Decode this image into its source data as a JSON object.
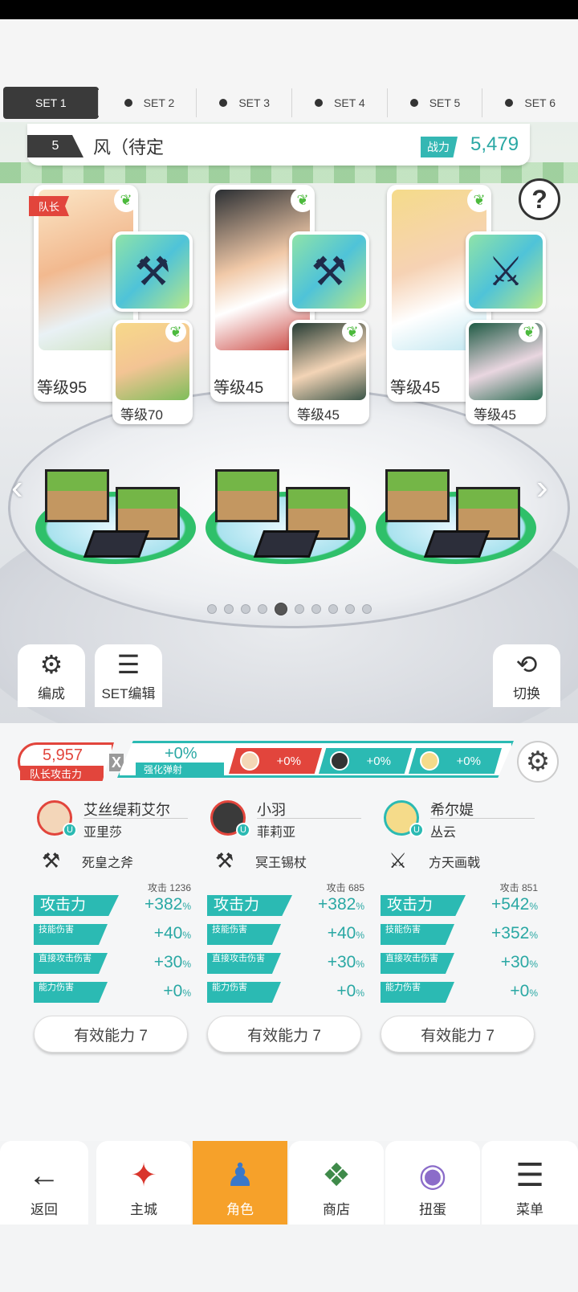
{
  "set_tabs": [
    {
      "label": "SET 1",
      "active": true
    },
    {
      "label": "SET 2",
      "active": false
    },
    {
      "label": "SET 3",
      "active": false
    },
    {
      "label": "SET 4",
      "active": false
    },
    {
      "label": "SET 5",
      "active": false
    },
    {
      "label": "SET 6",
      "active": false
    }
  ],
  "party": {
    "number": "5",
    "name": "风（待定",
    "power_label": "战力",
    "power": "5,479"
  },
  "help_icon": "question-icon",
  "teams": [
    {
      "leader_tag": "队长",
      "main_level": "等级95",
      "sub_level": "等级70",
      "weapon_icon": "axe-icon"
    },
    {
      "main_level": "等级45",
      "sub_level": "等级45",
      "weapon_icon": "axe-icon"
    },
    {
      "main_level": "等级45",
      "sub_level": "等级45",
      "weapon_icon": "halberd-icon"
    }
  ],
  "page_dots": {
    "count": 10,
    "active_index": 4
  },
  "tools": {
    "formation": "编成",
    "set_edit": "SET编辑",
    "switch": "切换"
  },
  "leader_attack": {
    "value": "5,957",
    "label": "队长攻击力"
  },
  "multiplier": "X",
  "enhance": {
    "value": "+0%",
    "label": "强化弹射"
  },
  "chips": [
    "+0%",
    "+0%",
    "+0%"
  ],
  "characters": [
    {
      "name": "艾丝缇莉艾尔",
      "sub": "亚里莎",
      "weapon": "死皇之斧",
      "atk_label": "攻击",
      "atk": "1236",
      "stats": [
        {
          "label": "攻击力",
          "value": "+382",
          "unit": "%"
        },
        {
          "label": "技能伤害",
          "value": "+40",
          "unit": "%"
        },
        {
          "label": "直接攻击伤害",
          "value": "+30",
          "unit": "%"
        },
        {
          "label": "能力伤害",
          "value": "+0",
          "unit": "%"
        }
      ],
      "effective": "有效能力 7"
    },
    {
      "name": "小羽",
      "sub": "菲莉亚",
      "weapon": "冥王锡杖",
      "atk_label": "攻击",
      "atk": "685",
      "stats": [
        {
          "label": "攻击力",
          "value": "+382",
          "unit": "%"
        },
        {
          "label": "技能伤害",
          "value": "+40",
          "unit": "%"
        },
        {
          "label": "直接攻击伤害",
          "value": "+30",
          "unit": "%"
        },
        {
          "label": "能力伤害",
          "value": "+0",
          "unit": "%"
        }
      ],
      "effective": "有效能力 7"
    },
    {
      "name": "希尔媞",
      "sub": "丛云",
      "weapon": "方天画戟",
      "atk_label": "攻击",
      "atk": "851",
      "stats": [
        {
          "label": "攻击力",
          "value": "+542",
          "unit": "%"
        },
        {
          "label": "技能伤害",
          "value": "+352",
          "unit": "%"
        },
        {
          "label": "直接攻击伤害",
          "value": "+30",
          "unit": "%"
        },
        {
          "label": "能力伤害",
          "value": "+0",
          "unit": "%"
        }
      ],
      "effective": "有效能力 7"
    }
  ],
  "nav": [
    {
      "label": "返回",
      "icon": "back-arrow-icon"
    },
    {
      "label": "主城",
      "icon": "castle-icon"
    },
    {
      "label": "角色",
      "icon": "character-icon",
      "active": true
    },
    {
      "label": "商店",
      "icon": "shop-icon"
    },
    {
      "label": "扭蛋",
      "icon": "gacha-icon"
    },
    {
      "label": "菜单",
      "icon": "menu-icon"
    }
  ],
  "colors": {
    "accent_teal": "#2bbab3",
    "accent_red": "#e2453c",
    "nav_active": "#f6a12a"
  }
}
